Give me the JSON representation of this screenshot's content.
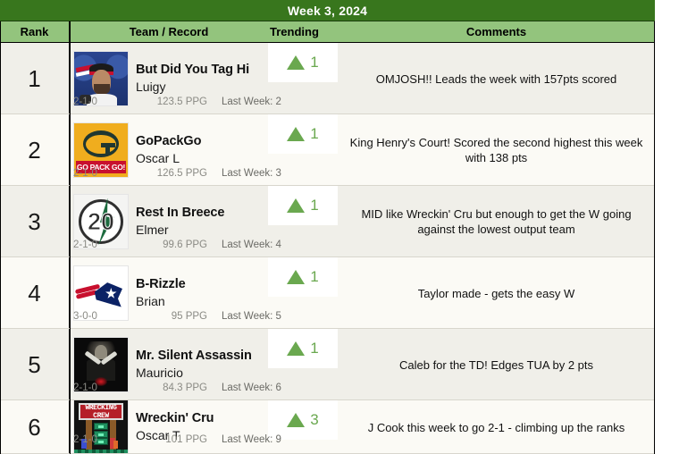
{
  "title": "Week 3, 2024",
  "columns": {
    "rank": "Rank",
    "team": "Team / Record",
    "trending": "Trending",
    "comments": "Comments"
  },
  "colors": {
    "title_bar": "#38761d",
    "header_row": "#93c47d",
    "row_odd": "#f0efe9",
    "row_even": "#fbfaf5",
    "trend_up": "#6aa84f",
    "trend_down": "#cc0000",
    "stat_text": "#8a8a84"
  },
  "rows": [
    {
      "rank": "1",
      "team_name": "But Did You Tag Hi",
      "owner": "Luigy",
      "record": "2-1-0",
      "ppg": "123.5 PPG",
      "last_week": "Last Week: 2",
      "trend_dir": "up",
      "trend_value": "1",
      "comment": "OMJOSH!! Leads the week with 157pts scored",
      "logo": "bills-press-conference-photo"
    },
    {
      "rank": "2",
      "team_name": "GoPackGo",
      "owner": "Oscar L",
      "record": "2-1-0",
      "ppg": "126.5 PPG",
      "last_week": "Last Week: 3",
      "trend_dir": "up",
      "trend_value": "1",
      "comment": "King Henry's Court! Scored the second highest this week with 138 pts",
      "logo": "green-bay-packers-go-pack-go"
    },
    {
      "rank": "3",
      "team_name": "Rest In Breece",
      "owner": "Elmer",
      "record": "2-1-0",
      "ppg": "99.6 PPG",
      "last_week": "Last Week: 4",
      "trend_dir": "up",
      "trend_value": "1",
      "comment": "MID like Wreckin' Cru but enough to get the W going against the lowest output team",
      "logo": "number-20-green-bolt-circle"
    },
    {
      "rank": "4",
      "team_name": "B-Rizzle",
      "owner": "Brian",
      "record": "3-0-0",
      "ppg": "95 PPG",
      "last_week": "Last Week: 5",
      "trend_dir": "up",
      "trend_value": "1",
      "comment": "Taylor made - gets the easy W",
      "logo": "new-england-patriots"
    },
    {
      "rank": "5",
      "team_name": "Mr. Silent Assassin",
      "owner": "Mauricio",
      "record": "2-1-0",
      "ppg": "84.3 PPG",
      "last_week": "Last Week: 6",
      "trend_dir": "up",
      "trend_value": "1",
      "comment": "Caleb for the TD! Edges TUA by 2 pts",
      "logo": "silent-assassin-dual-pistols"
    },
    {
      "rank": "6",
      "team_name": "Wreckin' Cru",
      "owner": "Oscar T",
      "record": "2-1-0",
      "ppg": "101 PPG",
      "last_week": "Last Week: 9",
      "trend_dir": "up",
      "trend_value": "3",
      "comment": "J Cook this week to go 2-1 - climbing up the ranks",
      "logo": "wrecking-crew-nes-screenshot"
    }
  ],
  "wrecking_crew_logo": {
    "line1": "WRECKING",
    "line2": "CREW"
  },
  "packers_logo": {
    "band_text": "GO PACK GO!",
    "letter": "G"
  },
  "twenty_logo": {
    "number": "20"
  }
}
